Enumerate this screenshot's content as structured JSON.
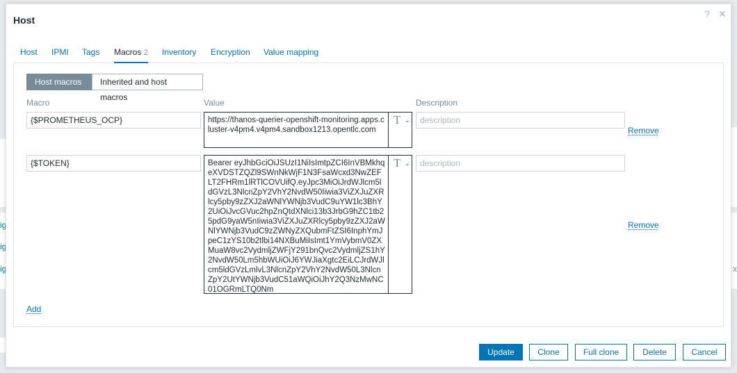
{
  "dialog": {
    "title": "Host",
    "help_icon": "?",
    "close_icon": "✕"
  },
  "tabs": [
    {
      "label": "Host"
    },
    {
      "label": "IPMI"
    },
    {
      "label": "Tags"
    },
    {
      "label": "Macros",
      "count": "2",
      "active": true
    },
    {
      "label": "Inventory"
    },
    {
      "label": "Encryption"
    },
    {
      "label": "Value mapping"
    }
  ],
  "macro_view": {
    "host_macros_label": "Host macros",
    "inherited_label": "Inherited and host macros"
  },
  "columns": {
    "macro": "Macro",
    "value": "Value",
    "description": "Description"
  },
  "rows": [
    {
      "macro": "{$PROMETHEUS_OCP}",
      "value": "https://thanos-querier-openshift-monitoring.apps.cluster-v4pm4.v4pm4.sandbox1213.opentlc.com",
      "type_icon": "T",
      "description_placeholder": "description",
      "remove_label": "Remove"
    },
    {
      "macro": "{$TOKEN}",
      "value": "Bearer eyJhbGciOiJSUzI1NiIsImtpZCI6InVBMkhqeXVDSTZQZl9SWnNkWjF1N3FsaWcxd3NwZEFLT2FHRm1lRTlCOVUifQ.eyJpc3MiOiJrdWJlcm5ldGVzL3NlcnZpY2VhY2NvdW50Iiwia3ViZXJuZXRlcy5pby9zZXJ2aWNlYWNjb3VudC9uYW1lc3BhY2UiOiJvcGVuc2hpZnQtdXNlci13b3JrbG9hZC1tb25pdG9yaW5nIiwia3ViZXJuZXRlcy5pby9zZXJ2aWNlYWNjb3VudC9zZWNyZXQubmFtZSI6InphYmJpeC1zYS10b2tlbi14NXBuMiIsImt1YmVybmV0ZXMuaW8vc2VydmljZWFjY291bnQvc2VydmljZS1hY2NvdW50Lm5hbWUiOiJ6YWJiaXgtc2EiLCJrdWJlcm5ldGVzLmlvL3NlcnZpY2VhY2NvdW50L3NlcnZpY2UtYWNjb3VudC51aWQiOiJhY2Q3NzMwNC01OGRmLTQ0Nm",
      "type_icon": "T",
      "description_placeholder": "description",
      "remove_label": "Remove"
    }
  ],
  "add_label": "Add",
  "footer": {
    "update": "Update",
    "clone": "Clone",
    "full_clone": "Full clone",
    "delete": "Delete",
    "cancel": "Cancel"
  },
  "background": {
    "left_fragments": [
      "ig",
      "ig",
      "ig"
    ],
    "right_fragment": "x"
  },
  "colors": {
    "accent": "#0275b8",
    "segment_active": "#768d99",
    "text": "#1f2c33",
    "muted": "#768d99"
  }
}
